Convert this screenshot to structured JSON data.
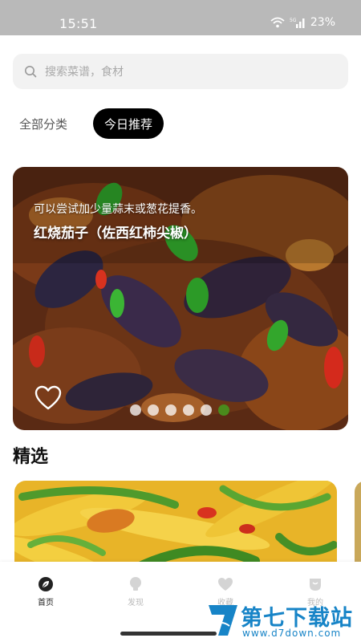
{
  "status_bar": {
    "time": "15:51",
    "battery": "23%",
    "network": "5G"
  },
  "search": {
    "placeholder": "搜索菜谱，食材"
  },
  "tabs": [
    {
      "label": "全部分类",
      "active": false
    },
    {
      "label": "今日推荐",
      "active": true
    }
  ],
  "banner": {
    "subtitle": "可以尝试加少量蒜末或葱花提香。",
    "title": "红烧茄子（佐西红柿尖椒）",
    "dots": {
      "count": 6,
      "active_index": 5
    }
  },
  "section": {
    "title": "精选"
  },
  "bottom_nav": [
    {
      "label": "首页",
      "icon": "home-leaf-icon",
      "active": true
    },
    {
      "label": "发现",
      "icon": "bulb-icon",
      "active": false
    },
    {
      "label": "收藏",
      "icon": "heart-icon",
      "active": false
    },
    {
      "label": "我的",
      "icon": "profile-icon",
      "active": false
    }
  ],
  "watermark": {
    "brand": "第七下载站",
    "url": "www.d7down.com"
  },
  "colors": {
    "accent": "#000000",
    "active_dot": "#4a8a1c",
    "watermark": "#1784c7"
  }
}
